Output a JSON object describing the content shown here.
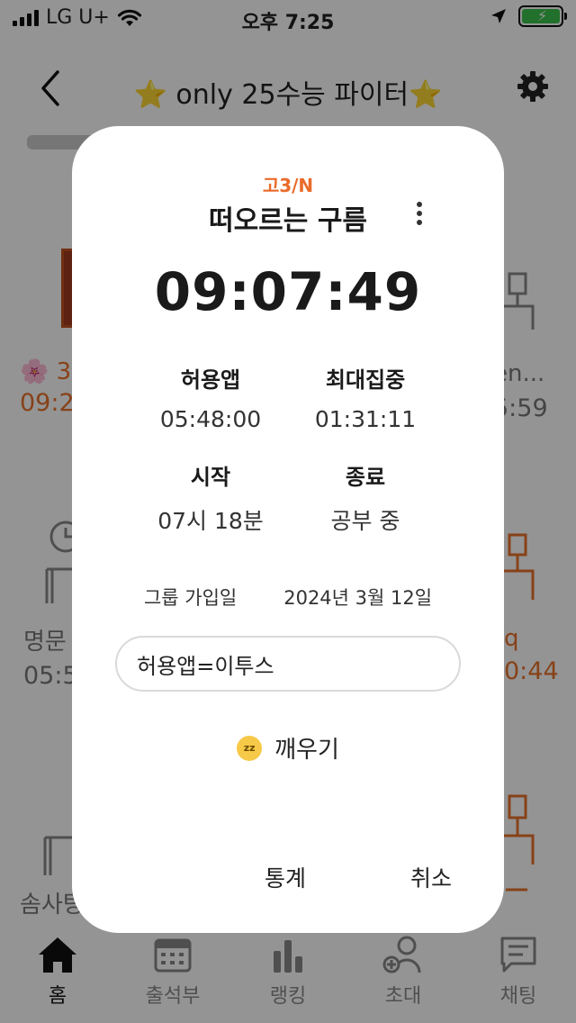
{
  "status_bar": {
    "carrier": "LG U+",
    "time": "오후 7:25"
  },
  "header": {
    "title": "⭐️ only 25수능 파이터⭐️"
  },
  "grid": {
    "left_top": {
      "name": "🌸 3.",
      "time": "09:2"
    },
    "right_top": {
      "name": "en...",
      "time": "5:59"
    },
    "left_mid": {
      "name": "명문",
      "time": "05:5"
    },
    "right_mid": {
      "name": "q",
      "time": "0:44"
    },
    "left_bottom": {
      "name": "솜사탕"
    }
  },
  "tabs": [
    {
      "label": "홈",
      "icon": "home-icon"
    },
    {
      "label": "출석부",
      "icon": "calendar-icon"
    },
    {
      "label": "랭킹",
      "icon": "bar-chart-icon"
    },
    {
      "label": "초대",
      "icon": "add-user-icon"
    },
    {
      "label": "채팅",
      "icon": "chat-icon"
    }
  ],
  "modal": {
    "group_tag": "고3/N",
    "user_name": "떠오르는 구름",
    "study_time": "09:07:49",
    "allowed_app_label": "허용앱",
    "allowed_app_value": "05:48:00",
    "max_focus_label": "최대집중",
    "max_focus_value": "01:31:11",
    "start_label": "시작",
    "start_value": "07시 18분",
    "end_label": "종료",
    "end_value": "공부 중",
    "join_label": "그룹 가입일",
    "join_date": "2024년 3월 12일",
    "memo_value": "허용앱=이투스",
    "wake_label": "깨우기",
    "stats_label": "통계",
    "cancel_label": "취소"
  },
  "colors": {
    "accent": "#ea6b2a",
    "overlay": "rgba(0,0,0,0.42)",
    "battery": "#39c24a"
  }
}
